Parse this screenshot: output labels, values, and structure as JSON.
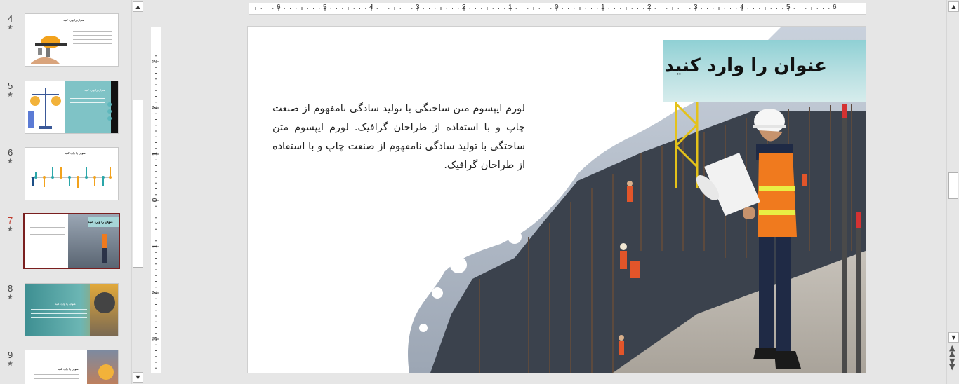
{
  "thumbnails": [
    {
      "number": "4",
      "star": "★",
      "title": "عنوان را وارد کنید"
    },
    {
      "number": "5",
      "star": "★",
      "title": "عنوان را وارد کنید"
    },
    {
      "number": "6",
      "star": "★",
      "title": "عنوان را وارد کنید"
    },
    {
      "number": "7",
      "star": "★",
      "title": "عنوان را وارد کنید"
    },
    {
      "number": "8",
      "star": "★",
      "title": "عنوان را وارد کنید"
    },
    {
      "number": "9",
      "star": "★",
      "title": "عنوان را وارد کنید"
    }
  ],
  "selected_slide": "7",
  "hruler_labels": [
    "6",
    "5",
    "4",
    "3",
    "2",
    "1",
    "0",
    "1",
    "2",
    "3",
    "4",
    "5",
    "6"
  ],
  "vruler_labels": [
    "3",
    "2",
    "1",
    "0",
    "1",
    "2",
    "3"
  ],
  "slide": {
    "title": "عنوان را وارد کنید",
    "body": "لورم ایپسوم متن ساختگی با تولید سادگی نامفهوم از صنعت چاپ و با استفاده از طراحان گرافیک. لورم ایپسوم متن ساختگی با تولید سادگی نامفهوم از صنعت چاپ و با استفاده از طراحان گرافیک."
  },
  "scroll_icons": {
    "up": "triangle-up",
    "down": "triangle-down",
    "prev_slide": "double-up",
    "next_slide": "double-down"
  },
  "colors": {
    "accent_selected": "#7a1f1f",
    "title_band": "#9fd6d8",
    "worker_vest": "#f07a1e"
  }
}
